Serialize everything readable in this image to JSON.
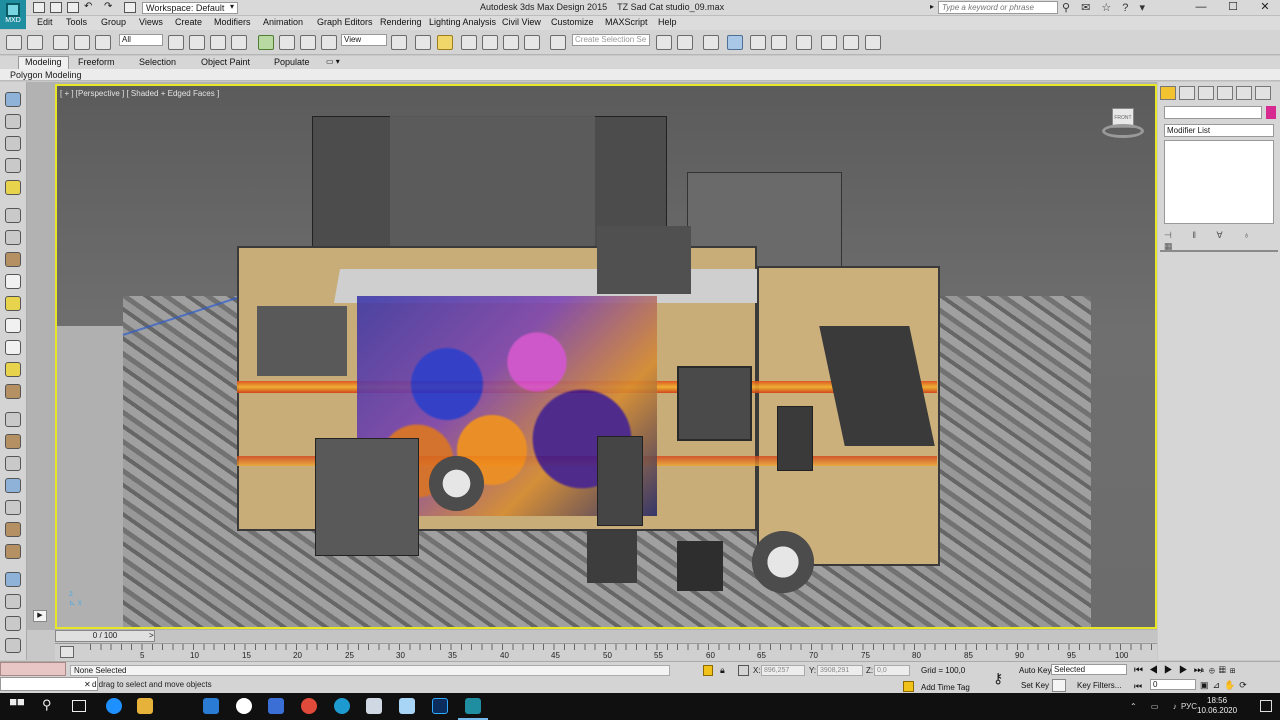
{
  "title": {
    "workspace": "Workspace: Default",
    "window_title": "Autodesk 3ds Max Design 2015",
    "file_name": "TZ Sad Cat studio_09.max",
    "search_placeholder": "Type a keyword or phrase",
    "logo_text": "MXD"
  },
  "menu": [
    "Edit",
    "Tools",
    "Group",
    "Views",
    "Create",
    "Modifiers",
    "Animation",
    "Graph Editors",
    "Rendering",
    "Lighting Analysis",
    "Civil View",
    "Customize",
    "MAXScript",
    "Help"
  ],
  "toolbar": {
    "selection_filter": "All",
    "ref_coord": "View",
    "named_selection_placeholder": "Create Selection Se"
  },
  "ribbon": {
    "tabs": [
      "Modeling",
      "Freeform",
      "Selection",
      "Object Paint",
      "Populate"
    ],
    "active_tab": "Modeling",
    "panel_label": "Polygon Modeling"
  },
  "viewport": {
    "label": "[ + ] [Perspective ] [ Shaded + Edged Faces ]",
    "viewcube_face": "FRONT"
  },
  "command_panel": {
    "modifier_list": "Modifier List"
  },
  "timeline": {
    "frame_display": "0 / 100",
    "ticks": [
      "5",
      "10",
      "15",
      "20",
      "25",
      "30",
      "35",
      "40",
      "45",
      "50",
      "55",
      "60",
      "65",
      "70",
      "75",
      "80",
      "85",
      "90",
      "95",
      "100"
    ]
  },
  "status": {
    "selection": "None Selected",
    "prompt": "d drag to select and move objects",
    "x_label": "X:",
    "x_value": "896,257",
    "y_label": "Y:",
    "y_value": "3908,291",
    "z_label": "Z:",
    "z_value": "0,0",
    "grid": "Grid = 100,0",
    "add_time_tag": "Add Time Tag",
    "auto_key": "Auto Key",
    "auto_key_value": "Selected",
    "set_key": "Set Key",
    "key_filters": "Key Filters...",
    "current_frame": "0"
  },
  "taskbar": {
    "lang": "РУС",
    "time": "18:56",
    "date": "10.06.2020"
  },
  "colors": {
    "viewport_border": "#e8e628",
    "accent_blue": "#1f8ea0",
    "object_color": "#d62a91"
  }
}
